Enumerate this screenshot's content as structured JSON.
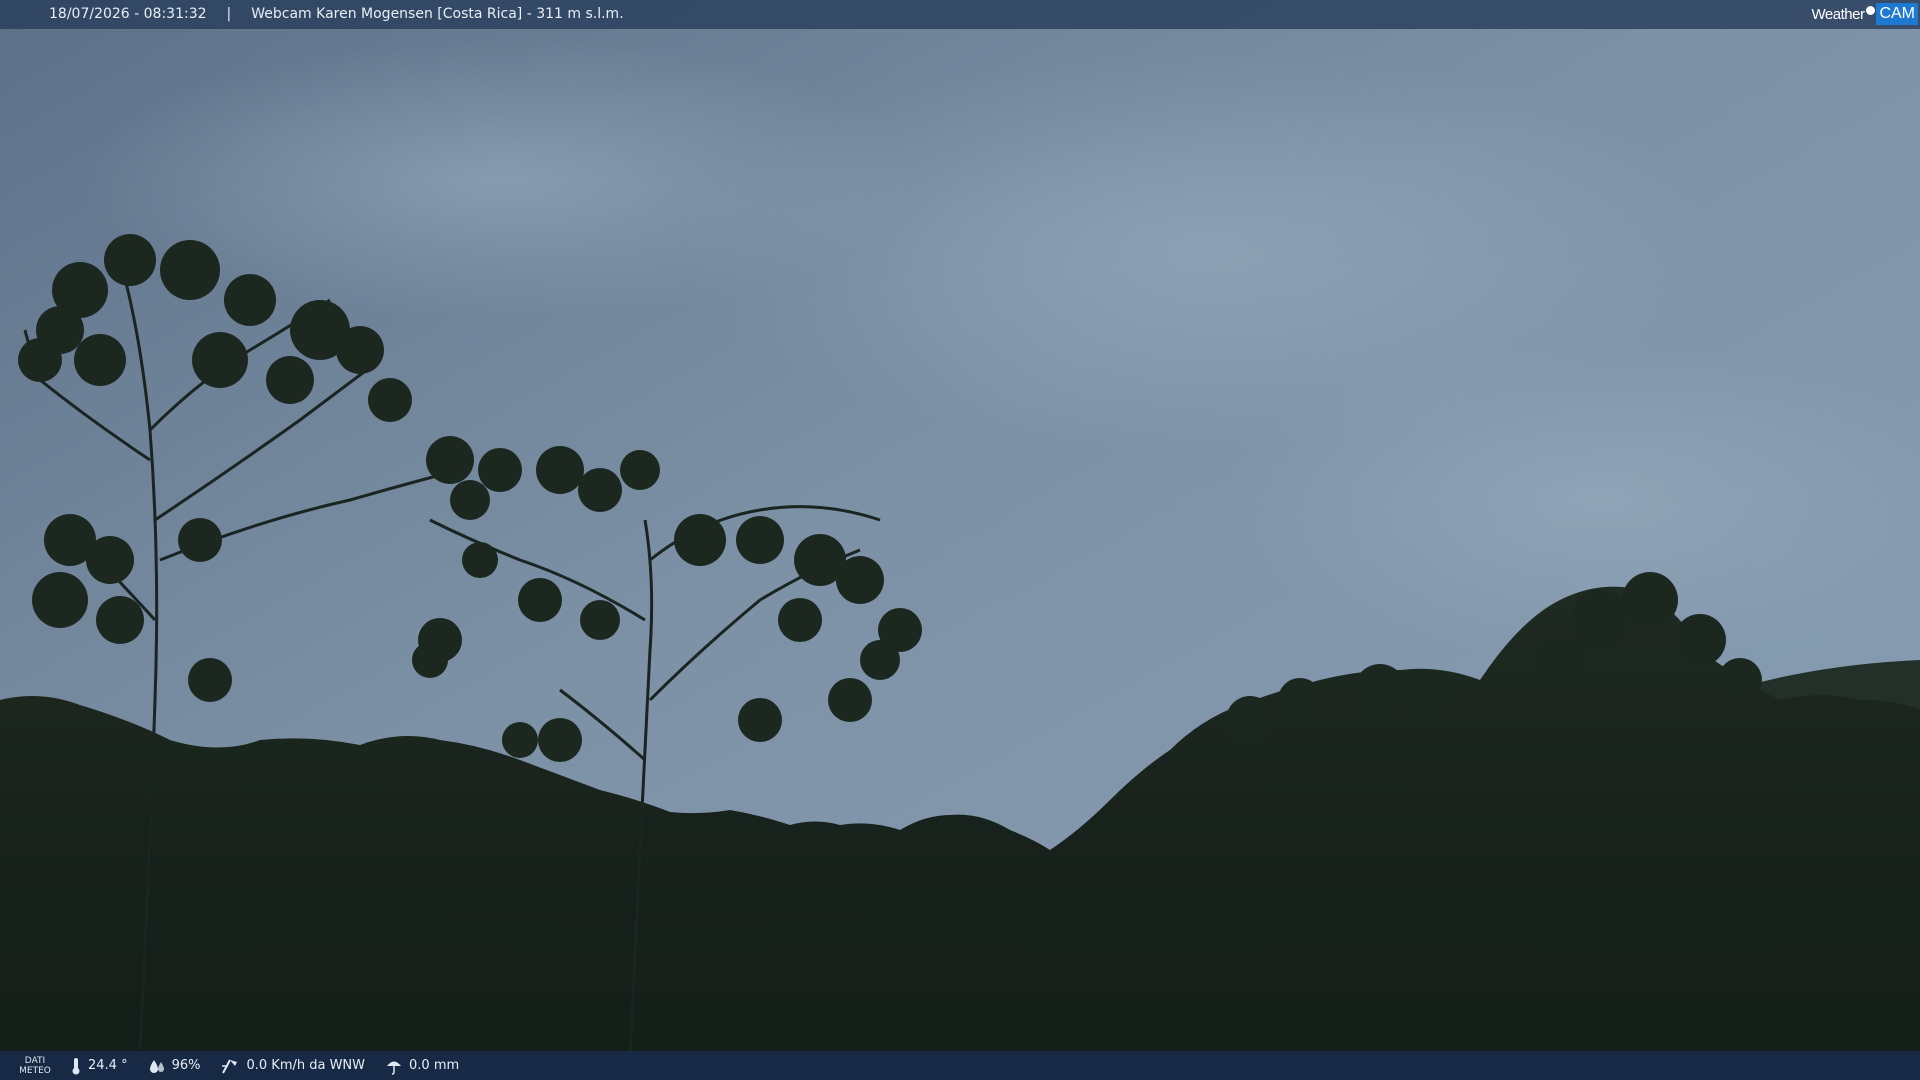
{
  "header": {
    "timestamp": "18/07/2026 - 08:31:32",
    "separator": "|",
    "title": "Webcam Karen Mogensen [Costa Rica]  - 311 m s.l.m."
  },
  "logo": {
    "text_weather": "Weather",
    "text_cam": "CAM",
    "accent": "#1e7ad0"
  },
  "meteo": {
    "label_line1": "DATI",
    "label_line2": "METEO",
    "temperature": "24.4 °",
    "humidity": "96%",
    "wind": "0.0 Km/h da WNW",
    "rain": "0.0 mm"
  },
  "icons": [
    "thermometer-icon",
    "humidity-drop-icon",
    "wind-icon",
    "rain-umbrella-icon"
  ]
}
